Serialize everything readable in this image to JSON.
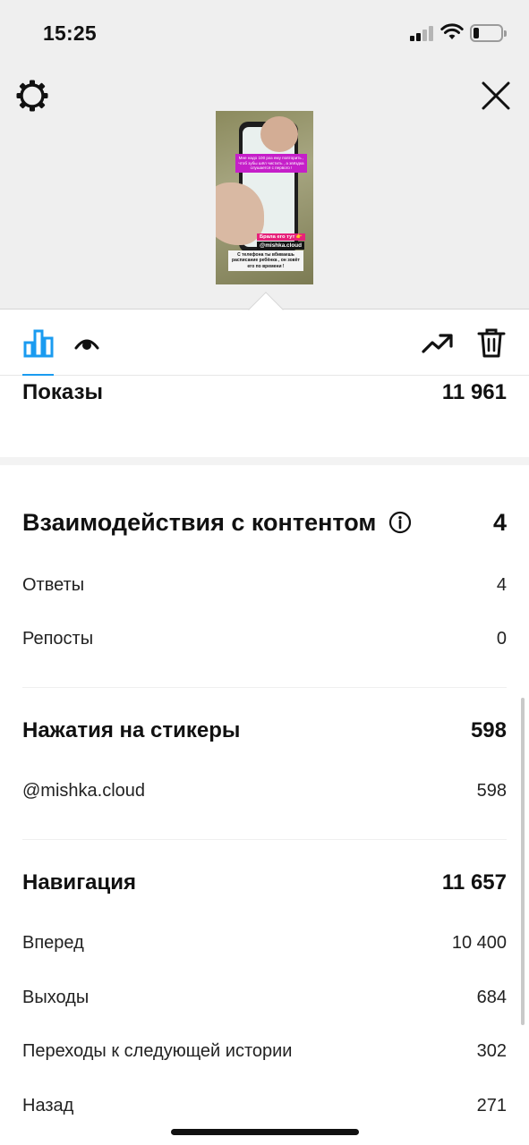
{
  "status_bar": {
    "time": "15:25",
    "signal_icon": "cellular-signal-icon",
    "wifi_icon": "wifi-icon",
    "battery_icon": "battery-icon",
    "battery_level": 0.2
  },
  "story_preview": {
    "settings_icon": "gear-icon",
    "close_icon": "close-icon",
    "caption_top": "Мне надо 100 раз ему повторить , чтоб зубы шёл чистить , а звёздка слушается с первого !",
    "sticker_text": "Брала его тут 👉",
    "mention": "@mishka.cloud",
    "caption_bottom": "С телефона ты вбиваешь расписание ребёнка , он зовёт его по времени !"
  },
  "tabs": {
    "insights_icon": "bar-chart-icon",
    "viewers_icon": "eye-icon",
    "promote_icon": "trending-up-icon",
    "delete_icon": "trash-icon",
    "accent_color": "#1a9bf0"
  },
  "metrics": {
    "impressions": {
      "label": "Показы",
      "value": "11 961"
    },
    "interactions": {
      "label": "Взаимодействия с контентом",
      "info_icon": "info-icon",
      "value": "4",
      "items": [
        {
          "label": "Ответы",
          "value": "4"
        },
        {
          "label": "Репосты",
          "value": "0"
        }
      ]
    },
    "sticker_taps": {
      "label": "Нажатия на стикеры",
      "value": "598",
      "items": [
        {
          "label": "@mishka.cloud",
          "value": "598"
        }
      ]
    },
    "navigation": {
      "label": "Навигация",
      "value": "11 657",
      "items": [
        {
          "label": "Вперед",
          "value": "10 400"
        },
        {
          "label": "Выходы",
          "value": "684"
        },
        {
          "label": "Переходы к следующей истории",
          "value": "302"
        },
        {
          "label": "Назад",
          "value": "271"
        }
      ]
    }
  }
}
